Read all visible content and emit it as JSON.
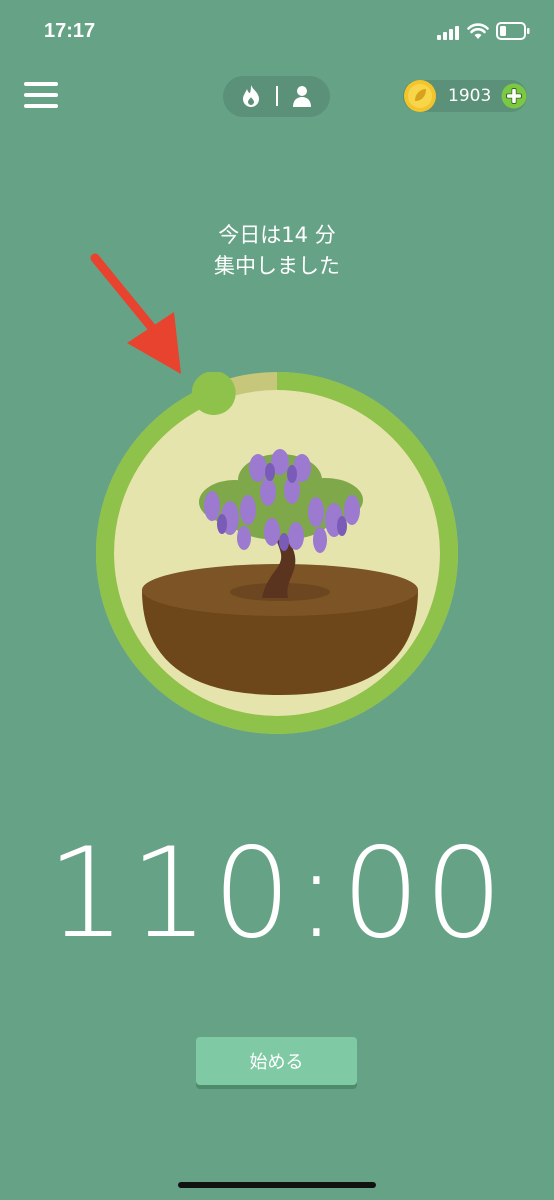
{
  "status_bar": {
    "time": "17:17"
  },
  "header": {
    "menu_icon": "hamburger-icon",
    "mode_toggle": {
      "left_icon": "flame-icon",
      "right_icon": "person-icon"
    },
    "coins": {
      "count": "1903",
      "icon": "coin-icon",
      "add_icon": "plus-icon"
    }
  },
  "main": {
    "today_line1": "今日は14 分",
    "today_line2": "集中しました",
    "timer": "110:00",
    "start_label": "始める",
    "progress_fraction": 0.94
  },
  "colors": {
    "background": "#66a386",
    "ring": "#8fc24a",
    "ring_track": "#c6c77a",
    "arrow": "#e8432e",
    "button": "#7fcaa4"
  }
}
